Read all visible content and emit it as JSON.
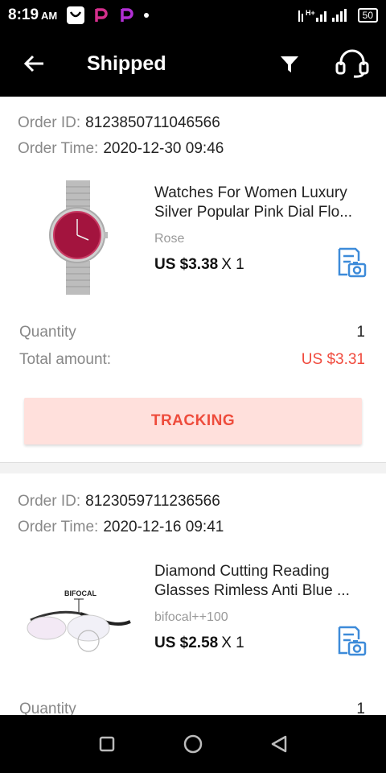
{
  "status_bar": {
    "time": "8:19",
    "ampm": "AM",
    "battery": "50",
    "network": "H+"
  },
  "app_bar": {
    "title": "Shipped"
  },
  "orders": [
    {
      "order_id_label": "Order ID:",
      "order_id": "8123850711046566",
      "order_time_label": "Order Time:",
      "order_time": "2020-12-30 09:46",
      "product_title_1": "Watches For Women Luxury",
      "product_title_2": "Silver Popular Pink Dial Flo...",
      "variant": "Rose",
      "price": "US $3.38",
      "qty": "X 1",
      "quantity_label": "Quantity",
      "quantity_value": "1",
      "total_label": "Total amount:",
      "total_value": "US $3.31",
      "tracking_label": "TRACKING"
    },
    {
      "order_id_label": "Order ID:",
      "order_id": "8123059711236566",
      "order_time_label": "Order Time:",
      "order_time": "2020-12-16 09:41",
      "product_title_1": "Diamond Cutting Reading",
      "product_title_2": "Glasses Rimless Anti Blue ...",
      "variant": "bifocal++100",
      "price": "US $2.58",
      "qty": "X 1",
      "image_caption": "BIFOCAL",
      "quantity_label": "Quantity",
      "quantity_value": "1"
    }
  ],
  "colors": {
    "accent_red": "#f04a3d",
    "tracking_bg": "#ffe0dc",
    "icon_blue": "#3d8bd9"
  },
  "icons": [
    "back-arrow-icon",
    "filter-icon",
    "headset-icon",
    "invoice-camera-icon",
    "square-nav-icon",
    "circle-nav-icon",
    "triangle-nav-icon"
  ]
}
